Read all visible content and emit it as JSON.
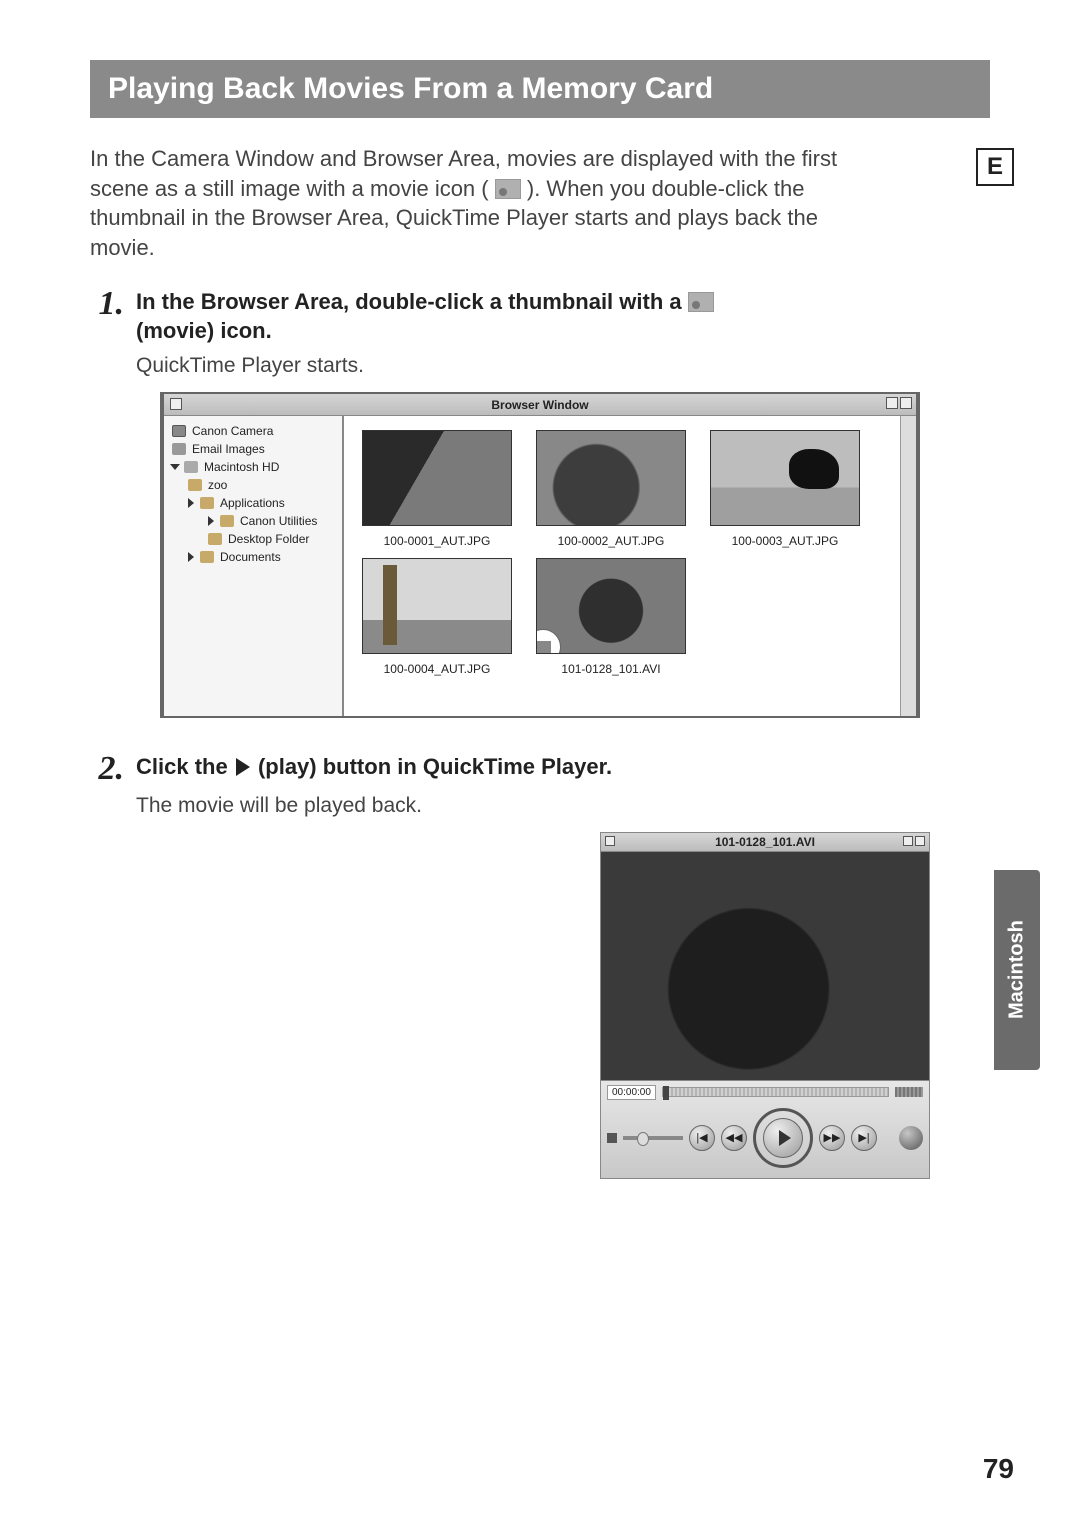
{
  "page": {
    "title": "Playing Back Movies From a Memory Card",
    "intro_a": "In the Camera Window and Browser Area, movies are displayed with the first scene as a still image with a movie icon (",
    "intro_b": "). When you double-click the thumbnail in the Browser Area, QuickTime Player starts and plays back the movie.",
    "side_letter": "E",
    "side_tab": "Macintosh",
    "page_number": "79"
  },
  "step1": {
    "num": "1.",
    "title_a": "In the Browser Area, double-click a thumbnail with a ",
    "title_b": "(movie) icon.",
    "sub": "QuickTime Player starts."
  },
  "browser": {
    "window_title": "Browser Window",
    "tree": {
      "item0": "Canon Camera",
      "item1": "Email Images",
      "item2": "Macintosh HD",
      "item3": "zoo",
      "item4": "Applications",
      "item5": "Canon Utilities",
      "item6": "Desktop Folder",
      "item7": "Documents"
    },
    "thumbs": {
      "t0": "100-0001_AUT.JPG",
      "t1": "100-0002_AUT.JPG",
      "t2": "100-0003_AUT.JPG",
      "t3": "100-0004_AUT.JPG",
      "t4": "101-0128_101.AVI"
    }
  },
  "step2": {
    "num": "2.",
    "title_a": "Click the ",
    "title_b": " (play) button in QuickTime Player.",
    "sub": "The movie will be played back."
  },
  "quicktime": {
    "title": "101-0128_101.AVI",
    "time": "00:00:00",
    "btn_begin": "|◀",
    "btn_rew": "◀◀",
    "btn_fwd": "▶▶",
    "btn_end": "▶|"
  }
}
